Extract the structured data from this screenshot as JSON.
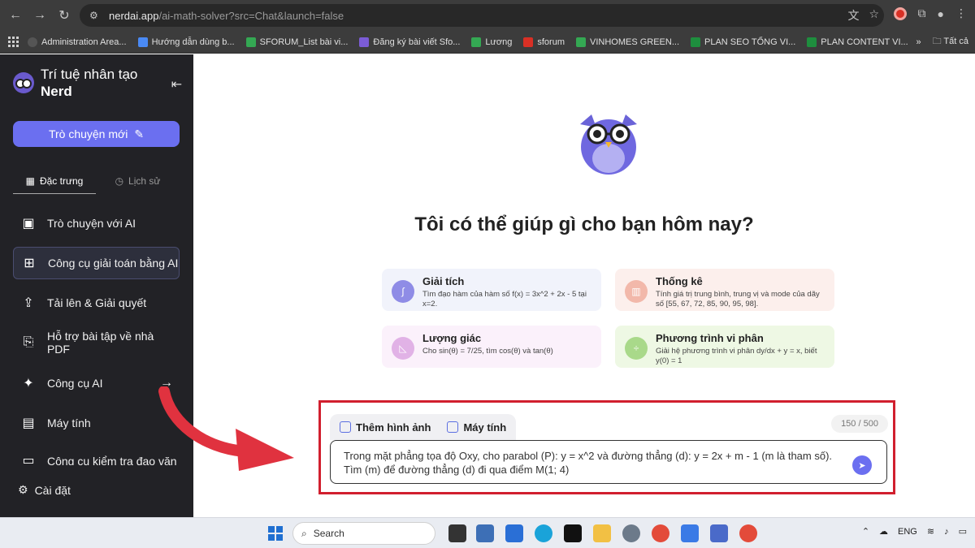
{
  "browser": {
    "url_host": "nerdai.app",
    "url_path": "/ai-math-solver?src=Chat&launch=false"
  },
  "bookmarks": {
    "items": [
      "Administration Area...",
      "Hướng dẫn dùng b...",
      "SFORUM_List bài vi...",
      "Đăng ký bài viết Sfo...",
      "Lương",
      "sforum",
      "VINHOMES GREEN...",
      "PLAN SEO TỔNG VI...",
      "PLAN CONTENT VI..."
    ],
    "more": "»",
    "all_folder": "Tất cả"
  },
  "sidebar": {
    "brand_line1": "Trí tuệ nhân tạo",
    "brand_line2": "Nerd",
    "new_chat": "Trò chuyện mới",
    "tab_features": "Đặc trưng",
    "tab_history": "Lịch sử",
    "items": [
      "Trò chuyện với AI",
      "Công cụ giải toán bằng AI",
      "Tải lên & Giải quyết",
      "Hỗ trợ bài tập về nhà PDF",
      "Công cụ AI",
      "Máy tính",
      "Công cụ kiểm tra đạo văn"
    ],
    "settings": "Cài đặt"
  },
  "main": {
    "greeting": "Tôi có thể giúp gì cho bạn hôm nay?",
    "cards": [
      {
        "title": "Giải tích",
        "desc": "Tìm đạo hàm của hàm số f(x) = 3x^2 + 2x - 5 tại x=2."
      },
      {
        "title": "Thống kê",
        "desc": "Tính giá trị trung bình, trung vị và mode của dãy số [55, 67, 72, 85, 90, 95, 98]."
      },
      {
        "title": "Lượng giác",
        "desc": "Cho sin(θ) = 7/25, tìm cos(θ) và tan(θ)"
      },
      {
        "title": "Phương trình vi phân",
        "desc": "Giải hệ phương trình vi phân dy/dx + y = x, biết y(0) = 1"
      }
    ],
    "tool_add_image": "Thêm hình ảnh",
    "tool_calculator": "Máy tính",
    "counter": "150 / 500",
    "input_text": "Trong mặt phẳng tọa độ Oxy, cho parabol (P): y = x^2 và đường thẳng (d): y = 2x + m - 1 (m là tham số). Tìm (m) để đường thẳng (d) đi qua điểm M(1; 4)"
  },
  "taskbar": {
    "search": "Search",
    "lang": "ENG"
  },
  "colors": {
    "accent": "#6b6ff0",
    "sidebar_bg": "#222226",
    "highlight_red": "#d11f2e"
  }
}
